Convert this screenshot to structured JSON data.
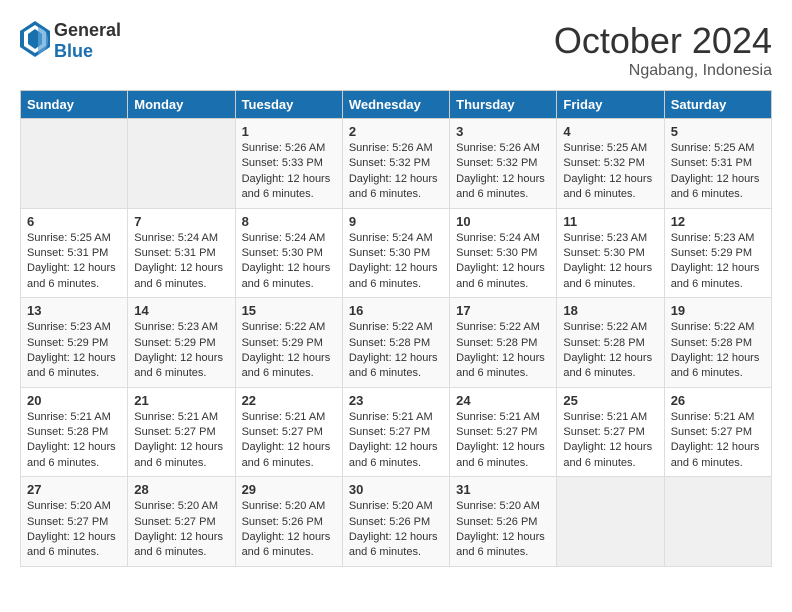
{
  "logo": {
    "general": "General",
    "blue": "Blue"
  },
  "title": {
    "month": "October 2024",
    "location": "Ngabang, Indonesia"
  },
  "headers": [
    "Sunday",
    "Monday",
    "Tuesday",
    "Wednesday",
    "Thursday",
    "Friday",
    "Saturday"
  ],
  "weeks": [
    [
      {
        "day": "",
        "sunrise": "",
        "sunset": "",
        "daylight": ""
      },
      {
        "day": "",
        "sunrise": "",
        "sunset": "",
        "daylight": ""
      },
      {
        "day": "1",
        "sunrise": "Sunrise: 5:26 AM",
        "sunset": "Sunset: 5:33 PM",
        "daylight": "Daylight: 12 hours and 6 minutes."
      },
      {
        "day": "2",
        "sunrise": "Sunrise: 5:26 AM",
        "sunset": "Sunset: 5:32 PM",
        "daylight": "Daylight: 12 hours and 6 minutes."
      },
      {
        "day": "3",
        "sunrise": "Sunrise: 5:26 AM",
        "sunset": "Sunset: 5:32 PM",
        "daylight": "Daylight: 12 hours and 6 minutes."
      },
      {
        "day": "4",
        "sunrise": "Sunrise: 5:25 AM",
        "sunset": "Sunset: 5:32 PM",
        "daylight": "Daylight: 12 hours and 6 minutes."
      },
      {
        "day": "5",
        "sunrise": "Sunrise: 5:25 AM",
        "sunset": "Sunset: 5:31 PM",
        "daylight": "Daylight: 12 hours and 6 minutes."
      }
    ],
    [
      {
        "day": "6",
        "sunrise": "Sunrise: 5:25 AM",
        "sunset": "Sunset: 5:31 PM",
        "daylight": "Daylight: 12 hours and 6 minutes."
      },
      {
        "day": "7",
        "sunrise": "Sunrise: 5:24 AM",
        "sunset": "Sunset: 5:31 PM",
        "daylight": "Daylight: 12 hours and 6 minutes."
      },
      {
        "day": "8",
        "sunrise": "Sunrise: 5:24 AM",
        "sunset": "Sunset: 5:30 PM",
        "daylight": "Daylight: 12 hours and 6 minutes."
      },
      {
        "day": "9",
        "sunrise": "Sunrise: 5:24 AM",
        "sunset": "Sunset: 5:30 PM",
        "daylight": "Daylight: 12 hours and 6 minutes."
      },
      {
        "day": "10",
        "sunrise": "Sunrise: 5:24 AM",
        "sunset": "Sunset: 5:30 PM",
        "daylight": "Daylight: 12 hours and 6 minutes."
      },
      {
        "day": "11",
        "sunrise": "Sunrise: 5:23 AM",
        "sunset": "Sunset: 5:30 PM",
        "daylight": "Daylight: 12 hours and 6 minutes."
      },
      {
        "day": "12",
        "sunrise": "Sunrise: 5:23 AM",
        "sunset": "Sunset: 5:29 PM",
        "daylight": "Daylight: 12 hours and 6 minutes."
      }
    ],
    [
      {
        "day": "13",
        "sunrise": "Sunrise: 5:23 AM",
        "sunset": "Sunset: 5:29 PM",
        "daylight": "Daylight: 12 hours and 6 minutes."
      },
      {
        "day": "14",
        "sunrise": "Sunrise: 5:23 AM",
        "sunset": "Sunset: 5:29 PM",
        "daylight": "Daylight: 12 hours and 6 minutes."
      },
      {
        "day": "15",
        "sunrise": "Sunrise: 5:22 AM",
        "sunset": "Sunset: 5:29 PM",
        "daylight": "Daylight: 12 hours and 6 minutes."
      },
      {
        "day": "16",
        "sunrise": "Sunrise: 5:22 AM",
        "sunset": "Sunset: 5:28 PM",
        "daylight": "Daylight: 12 hours and 6 minutes."
      },
      {
        "day": "17",
        "sunrise": "Sunrise: 5:22 AM",
        "sunset": "Sunset: 5:28 PM",
        "daylight": "Daylight: 12 hours and 6 minutes."
      },
      {
        "day": "18",
        "sunrise": "Sunrise: 5:22 AM",
        "sunset": "Sunset: 5:28 PM",
        "daylight": "Daylight: 12 hours and 6 minutes."
      },
      {
        "day": "19",
        "sunrise": "Sunrise: 5:22 AM",
        "sunset": "Sunset: 5:28 PM",
        "daylight": "Daylight: 12 hours and 6 minutes."
      }
    ],
    [
      {
        "day": "20",
        "sunrise": "Sunrise: 5:21 AM",
        "sunset": "Sunset: 5:28 PM",
        "daylight": "Daylight: 12 hours and 6 minutes."
      },
      {
        "day": "21",
        "sunrise": "Sunrise: 5:21 AM",
        "sunset": "Sunset: 5:27 PM",
        "daylight": "Daylight: 12 hours and 6 minutes."
      },
      {
        "day": "22",
        "sunrise": "Sunrise: 5:21 AM",
        "sunset": "Sunset: 5:27 PM",
        "daylight": "Daylight: 12 hours and 6 minutes."
      },
      {
        "day": "23",
        "sunrise": "Sunrise: 5:21 AM",
        "sunset": "Sunset: 5:27 PM",
        "daylight": "Daylight: 12 hours and 6 minutes."
      },
      {
        "day": "24",
        "sunrise": "Sunrise: 5:21 AM",
        "sunset": "Sunset: 5:27 PM",
        "daylight": "Daylight: 12 hours and 6 minutes."
      },
      {
        "day": "25",
        "sunrise": "Sunrise: 5:21 AM",
        "sunset": "Sunset: 5:27 PM",
        "daylight": "Daylight: 12 hours and 6 minutes."
      },
      {
        "day": "26",
        "sunrise": "Sunrise: 5:21 AM",
        "sunset": "Sunset: 5:27 PM",
        "daylight": "Daylight: 12 hours and 6 minutes."
      }
    ],
    [
      {
        "day": "27",
        "sunrise": "Sunrise: 5:20 AM",
        "sunset": "Sunset: 5:27 PM",
        "daylight": "Daylight: 12 hours and 6 minutes."
      },
      {
        "day": "28",
        "sunrise": "Sunrise: 5:20 AM",
        "sunset": "Sunset: 5:27 PM",
        "daylight": "Daylight: 12 hours and 6 minutes."
      },
      {
        "day": "29",
        "sunrise": "Sunrise: 5:20 AM",
        "sunset": "Sunset: 5:26 PM",
        "daylight": "Daylight: 12 hours and 6 minutes."
      },
      {
        "day": "30",
        "sunrise": "Sunrise: 5:20 AM",
        "sunset": "Sunset: 5:26 PM",
        "daylight": "Daylight: 12 hours and 6 minutes."
      },
      {
        "day": "31",
        "sunrise": "Sunrise: 5:20 AM",
        "sunset": "Sunset: 5:26 PM",
        "daylight": "Daylight: 12 hours and 6 minutes."
      },
      {
        "day": "",
        "sunrise": "",
        "sunset": "",
        "daylight": ""
      },
      {
        "day": "",
        "sunrise": "",
        "sunset": "",
        "daylight": ""
      }
    ]
  ]
}
